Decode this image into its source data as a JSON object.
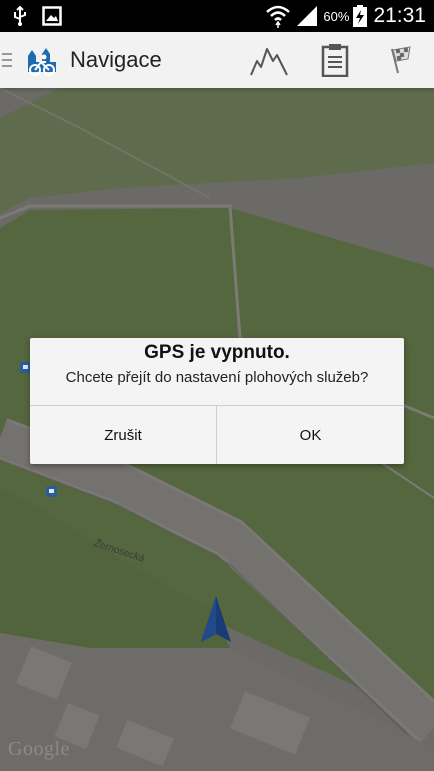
{
  "status_bar": {
    "battery_text": "60%",
    "time": "21:31"
  },
  "action_bar": {
    "title": "Navigace",
    "icons": [
      "menu-icon",
      "app-logo-icon",
      "elevation-profile-icon",
      "clipboard-icon",
      "checkered-flag-icon"
    ]
  },
  "map": {
    "street_label": "Žernosecká",
    "attribution": "Google"
  },
  "dialog": {
    "title": "GPS je vypnuto.",
    "message": "Chcete přejít do nastavení plohových služeb?",
    "cancel_label": "Zrušit",
    "ok_label": "OK"
  },
  "colors": {
    "status_bar": "#000000",
    "action_bar": "#f2f2f2",
    "map_green_dimmed": "#55673e",
    "map_gray_dimmed": "#6c6a66",
    "location_arrow": "#1a3b73",
    "dialog_background": "#f4f4f4"
  }
}
